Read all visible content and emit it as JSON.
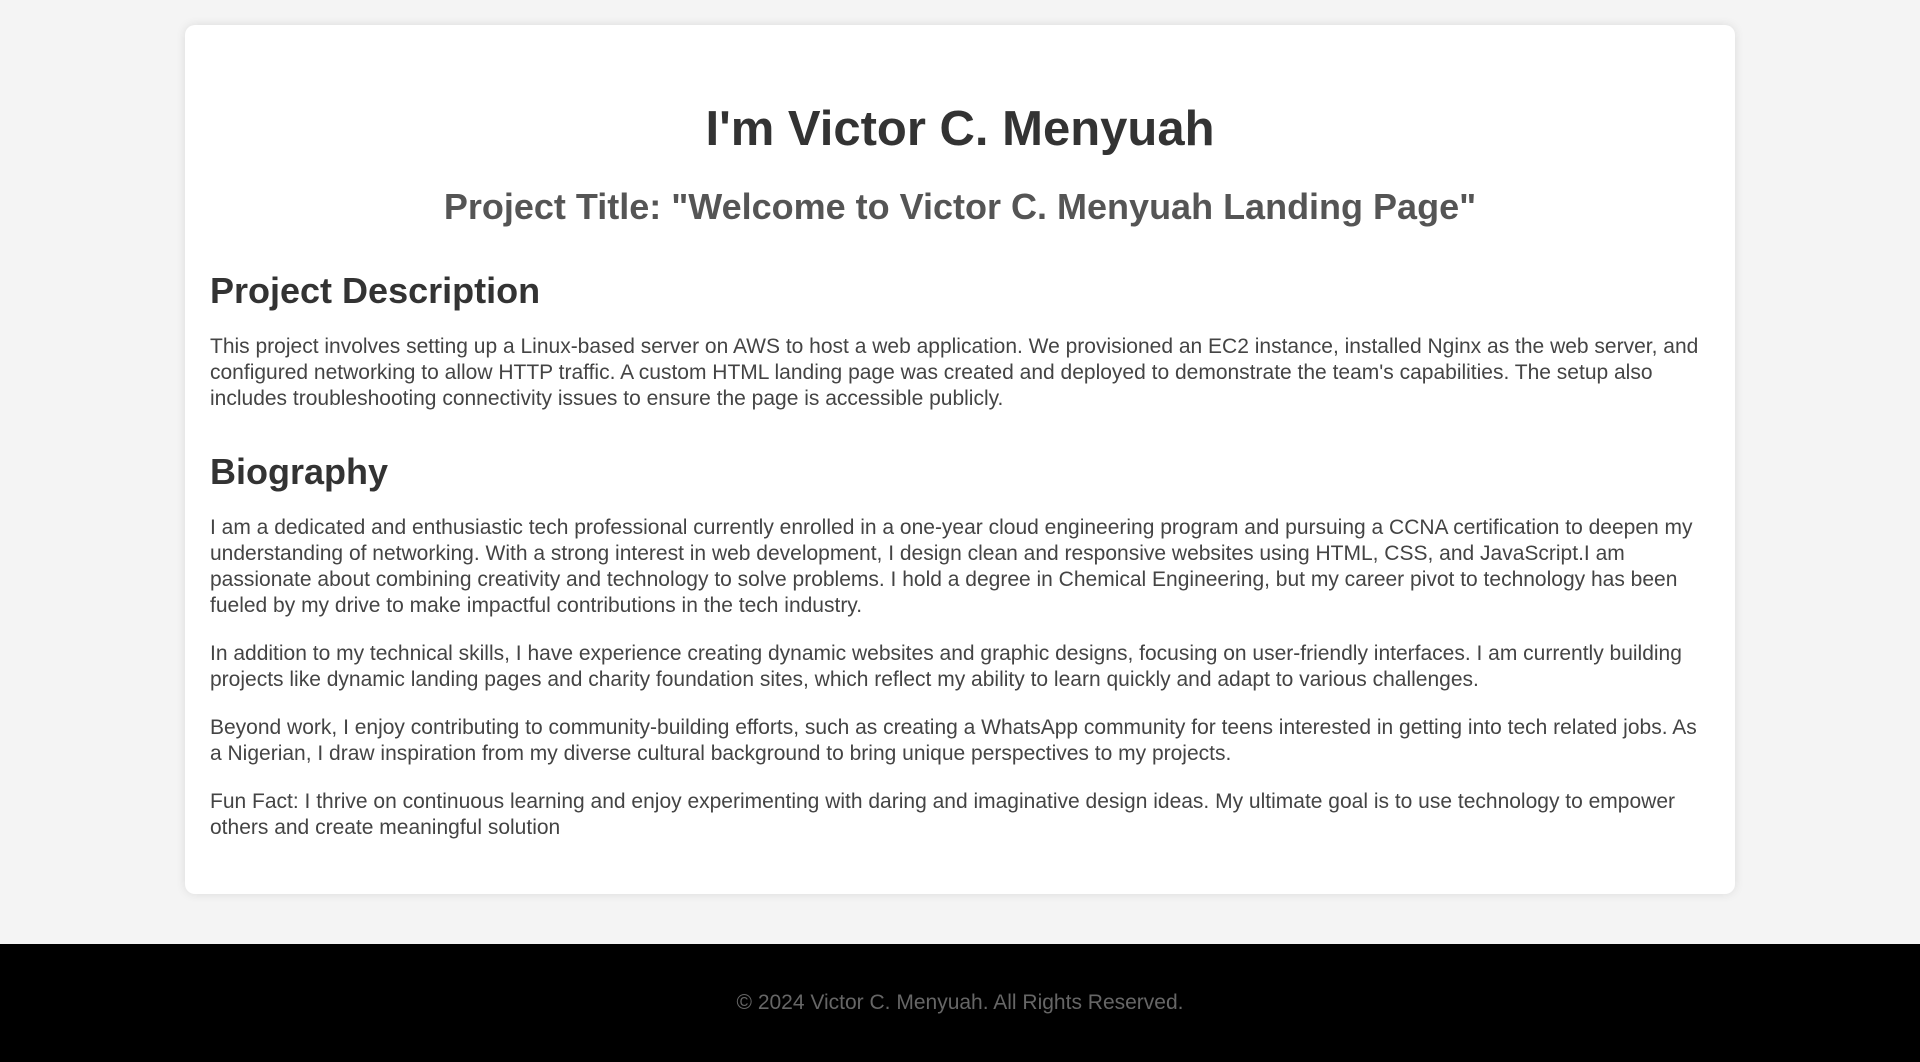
{
  "header": {
    "title": "I'm Victor C. Menyuah",
    "project_title": "Project Title: \"Welcome to Victor C. Menyuah Landing Page\""
  },
  "description": {
    "heading": "Project Description",
    "text": "This project involves setting up a Linux-based server on AWS to host a web application. We provisioned an EC2 instance, installed Nginx as the web server, and configured networking to allow HTTP traffic. A custom HTML landing page was created and deployed to demonstrate the team's capabilities. The setup also includes troubleshooting connectivity issues to ensure the page is accessible publicly."
  },
  "biography": {
    "heading": "Biography",
    "paragraphs": [
      "I am a dedicated and enthusiastic tech professional currently enrolled in a one-year cloud engineering program and pursuing a CCNA certification to deepen my understanding of networking. With a strong interest in web development, I design clean and responsive websites using HTML, CSS, and JavaScript.I am passionate about combining creativity and technology to solve problems. I hold a degree in Chemical Engineering, but my career pivot to technology has been fueled by my drive to make impactful contributions in the tech industry.",
      "In addition to my technical skills, I have experience creating dynamic websites and graphic designs, focusing on user-friendly interfaces. I am currently building projects like dynamic landing pages and charity foundation sites, which reflect my ability to learn quickly and adapt to various challenges.",
      "Beyond work, I enjoy contributing to community-building efforts, such as creating a WhatsApp community for teens interested in getting into tech related jobs. As a Nigerian, I draw inspiration from my diverse cultural background to bring unique perspectives to my projects.",
      "Fun Fact: I thrive on continuous learning and enjoy experimenting with daring and imaginative design ideas. My ultimate goal is to use technology to empower others and create meaningful solution"
    ]
  },
  "footer": {
    "text": "© 2024 Victor C. Menyuah. All Rights Reserved."
  }
}
